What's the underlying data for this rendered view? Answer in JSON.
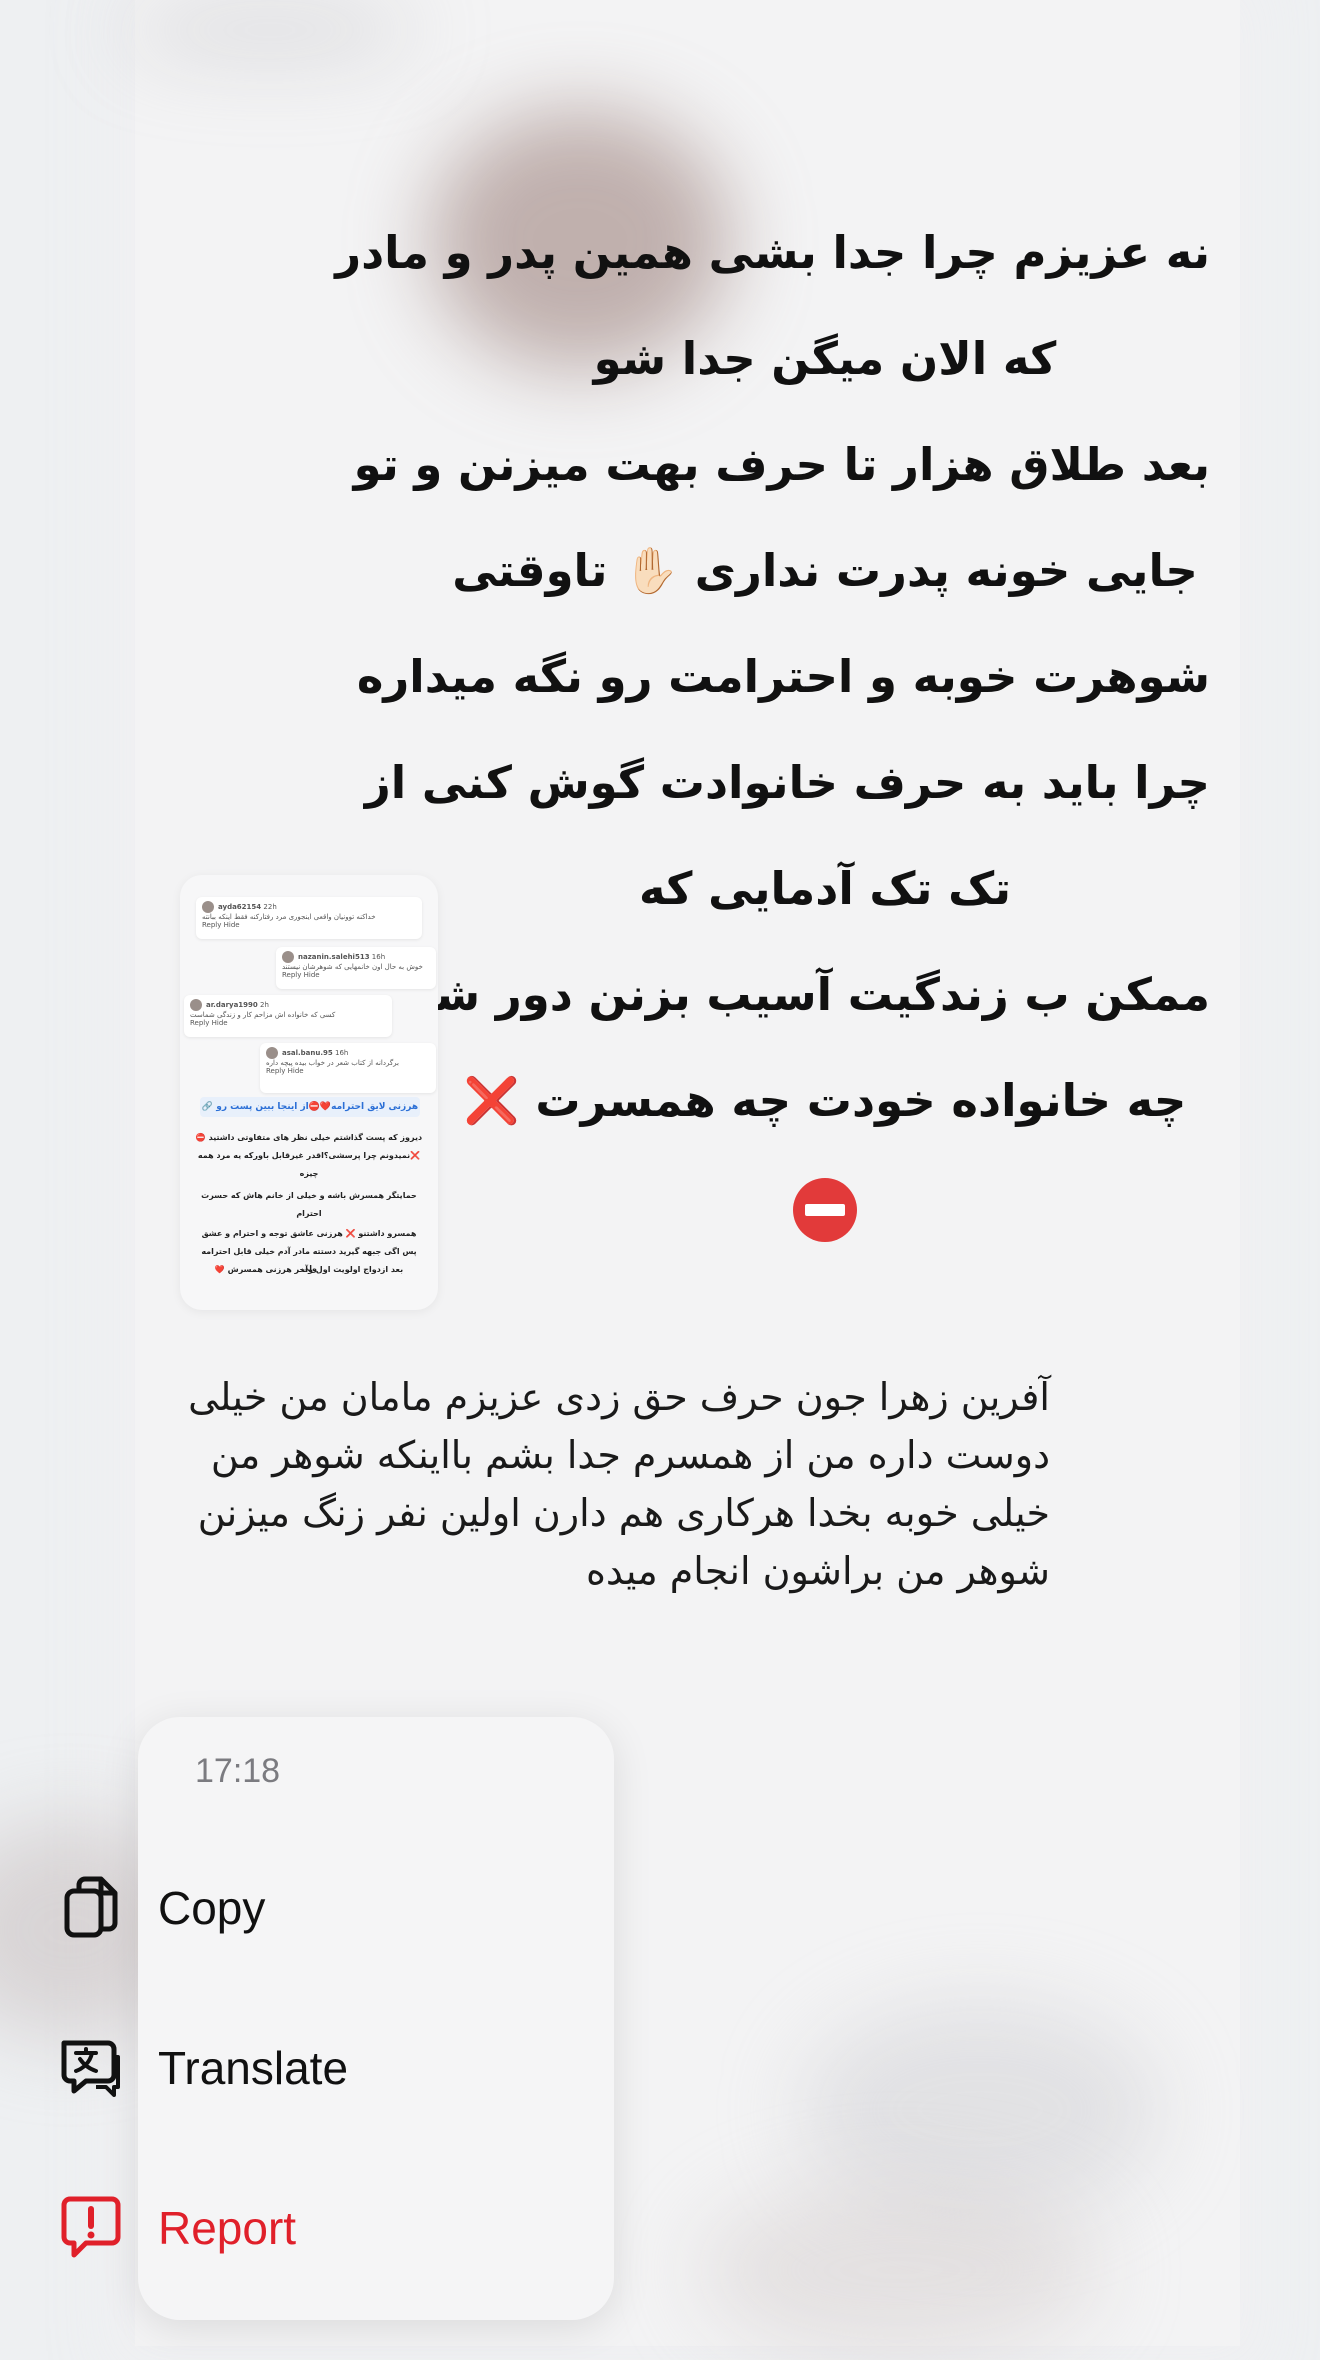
{
  "story": {
    "caption_lines": [
      "نه عزیزم چرا جدا بشی همین پدر و مادر",
      "که الان میگن جدا شو",
      "بعد طلاق هزار تا حرف بهت میزنن و تو",
      "جایی خونه پدرت نداری ✋🏻 تاوقتی",
      "شوهرت خوبه و احترامت رو نگه میداره",
      "چرا باید به حرف خانوادت گوش کنی از",
      "تک تک آدمایی که",
      "ممکن ب زندگیت آسیب بزنن دور شو",
      "چه خانواده خودت چه همسرت ❌"
    ],
    "thumbnail": {
      "comments": [
        {
          "user": "ayda62154",
          "time": "22h",
          "text": "خداکنه توونیان واقعی اینجوری مرد رفتارکنه فقط اینکه ببانته",
          "actions": "Reply   Hide"
        },
        {
          "user": "nazanin.salehi513",
          "time": "16h",
          "text": "خوش به حال اون خانمهایی که شوهرشان نیستند",
          "actions": "Reply   Hide"
        },
        {
          "user": "ar.darya1990",
          "time": "2h",
          "text": "کسی که خانواده اش مزاحم کار و زندگی شماست",
          "actions": "Reply   Hide"
        },
        {
          "user": "asal.banu.95",
          "time": "16h",
          "text": "برگردانه از کتاب شعر در خواب بیده پیچه داره",
          "actions": "Reply   Hide"
        }
      ],
      "header": "هرزنی لایق احترامه❤️⛔از اینجا ببین پست رو 🔗",
      "body_lines": [
        "دیروز که پست گذاشتم خیلی نظر های متفاوتی داشتید ⛔",
        "❌نمیدونم چرا پرسشی؟اقدر غیرقابل باورکه یه مرد همه",
        "چیزه",
        "حمایتگر همسرش باشه و خیلی از خانم هاش که حسرت",
        "احترام",
        "همسرو داشتنو ❌ هرزنی عاشق توجه و احترام و عشق",
        "پس اگی جبهه گیرید دستته مادر آدم خیلی قابل احترامه ولی",
        "بعد ازدواج اولویت اول وآخر هرزنی همسرش ❤️"
      ]
    }
  },
  "reply": {
    "text": "آفرین زهرا جون حرف حق زدی عزیزم مامان من خیلی دوست داره من از همسرم جدا بشم بااینکه شوهر من خیلی خوبه بخدا هرکاری هم دارن اولین نفر زنگ میزنن شوهر من براشون انجام میده"
  },
  "context_menu": {
    "timestamp": "17:18",
    "items": [
      {
        "label": "Copy",
        "icon": "copy-icon"
      },
      {
        "label": "Translate",
        "icon": "translate-icon"
      },
      {
        "label": "Report",
        "icon": "report-icon",
        "color": "#e0202a"
      }
    ]
  }
}
